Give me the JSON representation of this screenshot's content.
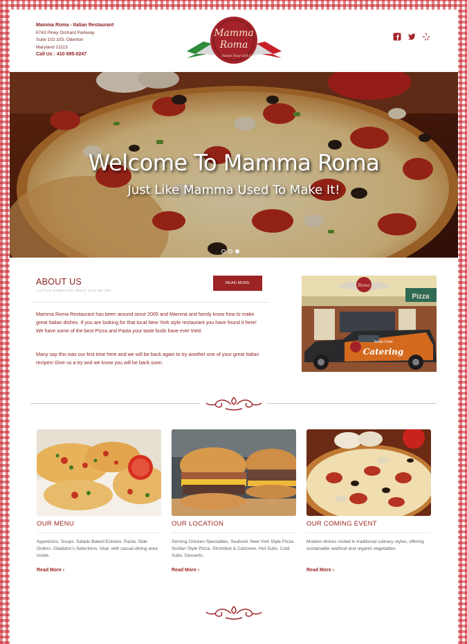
{
  "header": {
    "restaurant_name": "Mamma Roma - Italian Restaurant",
    "address_line1": "8743 Piney Orchard Parkway",
    "address_line2": "Suite 102 103, Odenton",
    "address_line3": "Maryland 21113",
    "phone": "Call Us : 410 695-0247",
    "logo_text_line1": "Mamma",
    "logo_text_line2": "Roma",
    "logo_tagline": "Italian Food with Love",
    "social_icons": [
      "facebook-icon",
      "twitter-icon",
      "yelp-icon"
    ]
  },
  "hero": {
    "title": "Welcome To Mamma Roma",
    "subtitle": "Just Like Mamma Used To Make It!",
    "slides": 3,
    "active_slide": 3
  },
  "about": {
    "title": "ABOUT US",
    "tagline": "A LITTLE SOMETHING ABOUT WHO WE ARE",
    "button_label": "READ MORE",
    "paragraph1": "Mamma Roma Restaurant has been around since 2005 and Mamma and family know how to make great Italian dishes. If you are looking for that local New York style restaurant you have found it here! We have some of the best Pizza and Pasta your taste buds have ever tried.",
    "paragraph2": "Many say this was our first time here and we will be back again to try another one of your great Italian recipes! Give us a try and we know you will be back soon.",
    "image_sign_text": "Pizza",
    "van_text": "Catering",
    "van_small_text": "Italian Food"
  },
  "cards": [
    {
      "title": "OUR MENU",
      "text": "Appetizers. Soups. Salads Baked Entrées. Pasta. Side Orders. Gladiator's Selections. Veal. with casual dining area inside.",
      "link": "Read More ›"
    },
    {
      "title": "OUR LOCATION",
      "text": "Serving Chicken Specialties. Seafood. New York Style Pizza. Sicilian Style Pizza. Stromboli & Calzones. Hot Subs. Cold Subs. Desserts.",
      "link": "Read More ›"
    },
    {
      "title": "OUR COMING EVENT",
      "text": "Modern dishes rooted in traditional culinary styles, offering sustainable seafood and organic vegetables",
      "link": "Read More ›"
    }
  ],
  "colors": {
    "brand_red": "#9c2424",
    "text_red": "#8b1c1c",
    "checker": "#c81e28"
  }
}
